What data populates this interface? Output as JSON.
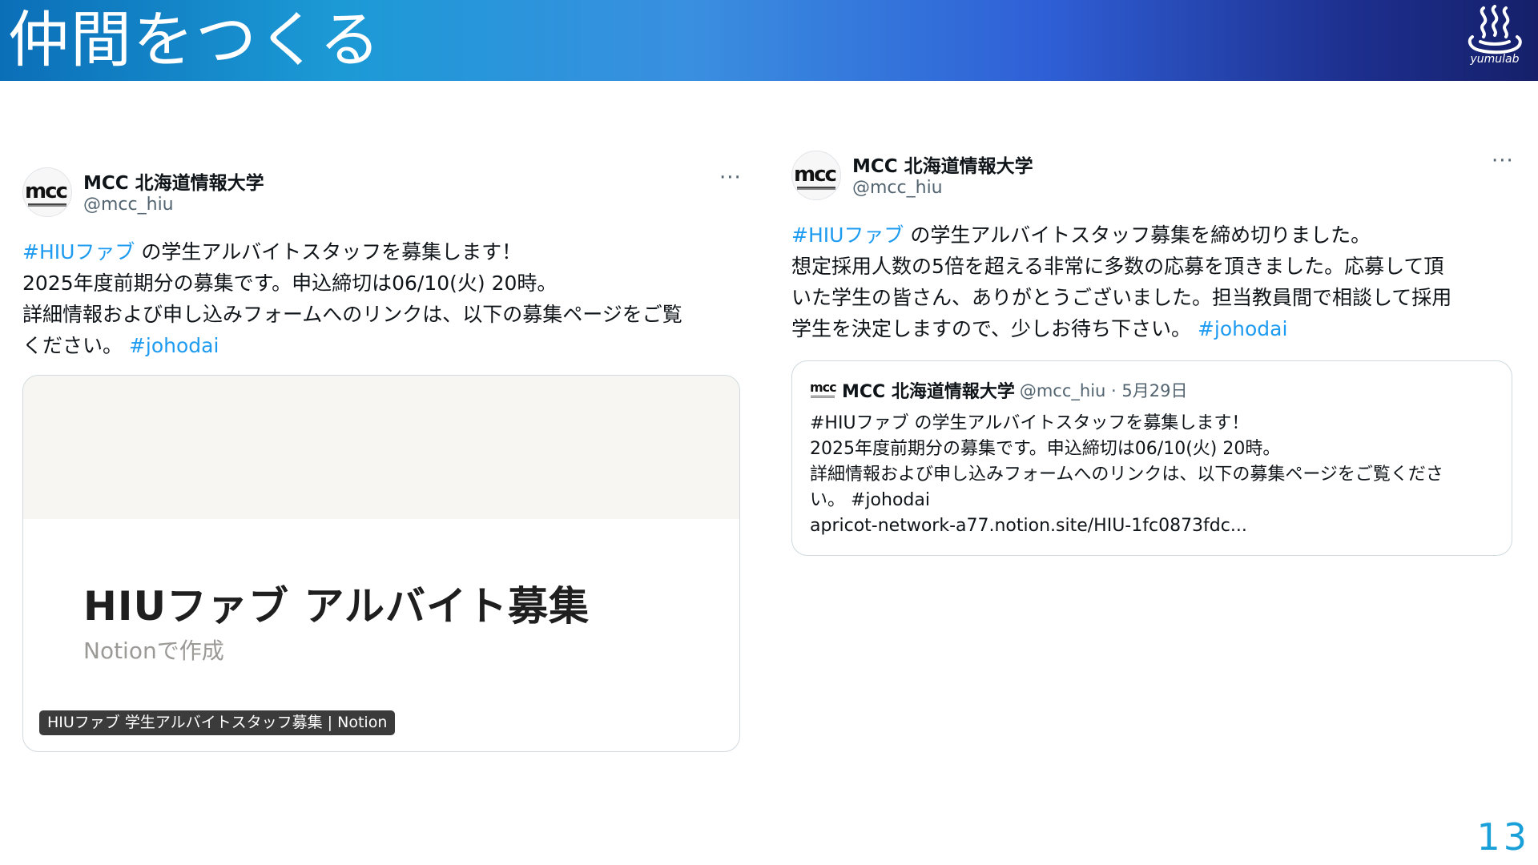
{
  "slide": {
    "title": "仲間をつくる",
    "logo_text": "yumulab",
    "page_number": "13"
  },
  "colors": {
    "hashtag": "#1d9bf0",
    "page_number": "#1aa0d8",
    "banner_start": "#0b6fb8",
    "banner_end": "#16206a"
  },
  "tweet_left": {
    "author_name": "MCC 北海道情報大学",
    "handle": "@mcc_hiu",
    "avatar_mark": "mcc",
    "more_icon": "···",
    "line1_tag": "#HIUファブ",
    "line1_text": " の学生アルバイトスタッフを募集します！",
    "line2": "2025年度前期分の募集です。申込締切は06/10(火) 20時。",
    "line3": "詳細情報および申し込みフォームへのリンクは、以下の募集ページをご覧",
    "line4_text": "ください。 ",
    "line4_tag": "#johodai",
    "link_card": {
      "title": "HIUファブ アルバイト募集",
      "subtitle": "Notionで作成",
      "caption": "HIUファブ 学生アルバイトスタッフ募集 | Notion"
    }
  },
  "tweet_right": {
    "author_name": "MCC 北海道情報大学",
    "handle": "@mcc_hiu",
    "avatar_mark": "mcc",
    "more_icon": "···",
    "line1_tag": "#HIUファブ",
    "line1_text": " の学生アルバイトスタッフ募集を締め切りました。",
    "line2": "想定採用人数の5倍を超える非常に多数の応募を頂きました。応募して頂",
    "line3": "いた学生の皆さん、ありがとうございました。担当教員間で相談して採用",
    "line4_text": "学生を決定しますので、少しお待ち下さい。 ",
    "line4_tag": "#johodai",
    "quote": {
      "avatar_mark": "mcc",
      "author_name": "MCC 北海道情報大学",
      "meta": "@mcc_hiu · 5月29日",
      "line1": "#HIUファブ の学生アルバイトスタッフを募集します！",
      "line2": "2025年度前期分の募集です。申込締切は06/10(火) 20時。",
      "line3": "詳細情報および申し込みフォームへのリンクは、以下の募集ページをご覧くださ",
      "line4": "い。 #johodai",
      "line5": "apricot-network-a77.notion.site/HIU-1fc0873fdc..."
    }
  }
}
